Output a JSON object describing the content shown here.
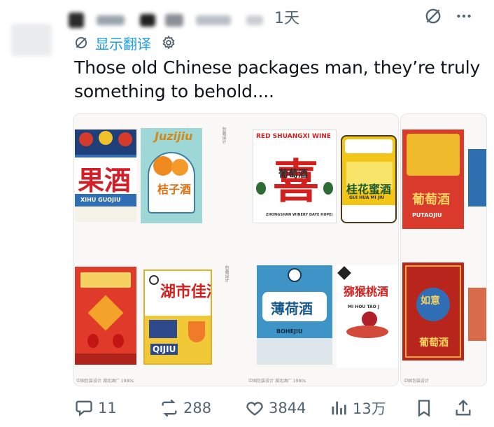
{
  "header": {
    "time": "1天",
    "hide_icon": "eye-slash-icon",
    "more_icon": "ellipsis-icon"
  },
  "translate": {
    "label": "显示翻译",
    "settings_icon": "gear-icon"
  },
  "tweet": {
    "text": "Those old Chinese packages man, they’re truly something to behold...."
  },
  "media": {
    "labels": {
      "guojiu_text": "果酒",
      "xihu": "XIHU GUOJIU",
      "juzijiu_title": "Juzijiu",
      "juzijiu_text": "桔子酒",
      "red_shuangxi": "RED SHUANGXI WINE",
      "putaojiu_small": "葡萄酒",
      "zhongshan": "ZHONGSHAN WINERY DAYE HUPEI",
      "guihua": "桂花蜜酒",
      "guihua_en": "GUI HUA MI JIU",
      "putaojiu_big": "葡萄酒",
      "putaojiu_en": "PUTAOJIU",
      "shijiu_text": "喜",
      "qijiu_text": "湖市佳酒",
      "qijiu_en": "QIJIU",
      "bohe_text": "薄荷酒",
      "bohe_en": "BOHEJIU",
      "mihou_text": "猕猴桃酒",
      "mihou_en": "MI HOU TAO J",
      "ruyi_text": "如意",
      "ruyi_sub": "葡萄酒"
    }
  },
  "actions": {
    "reply_count": "11",
    "retweet_count": "288",
    "like_count": "3844",
    "views_count": "13万"
  }
}
